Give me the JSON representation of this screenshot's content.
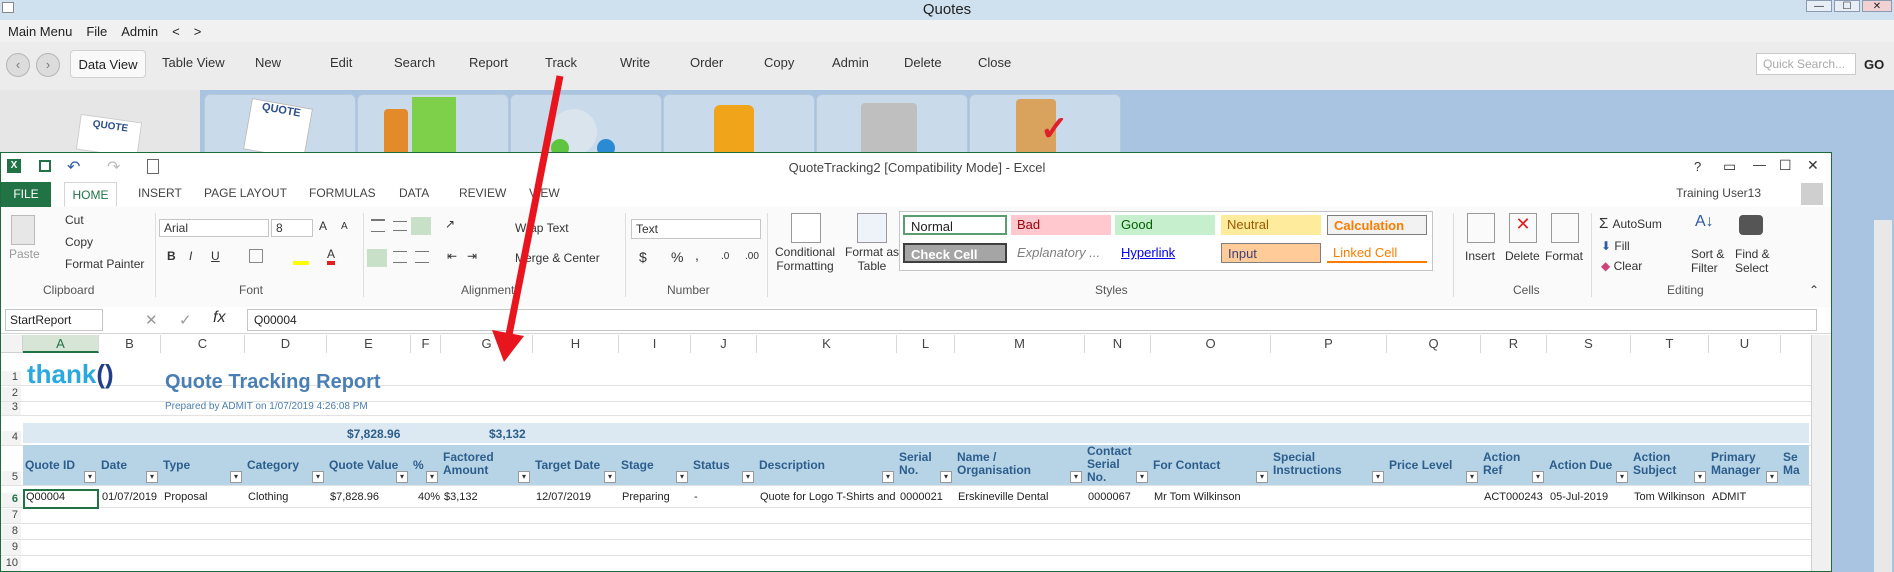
{
  "app": {
    "title": "Quotes",
    "menu": [
      "Main Menu",
      "File",
      "Admin",
      "<",
      ">"
    ],
    "toolbar": [
      "Data View",
      "Table View",
      "New",
      "Edit",
      "Search",
      "Report",
      "Track",
      "Write",
      "Order",
      "Copy",
      "Admin",
      "Delete",
      "Close"
    ],
    "quick_search_placeholder": "Quick Search...",
    "go_label": "GO",
    "tile_texts": [
      "QUOTE",
      "QUOTE"
    ]
  },
  "excel": {
    "title": "QuoteTracking2  [Compatibility Mode] - Excel",
    "window_buttons": [
      "?",
      "▭",
      "—",
      "☐",
      "✕"
    ],
    "tabs": [
      "FILE",
      "HOME",
      "INSERT",
      "PAGE LAYOUT",
      "FORMULAS",
      "DATA",
      "REVIEW",
      "VIEW"
    ],
    "user": "Training User13",
    "clipboard": {
      "paste": "Paste",
      "cut": "Cut",
      "copy": "Copy",
      "format_painter": "Format Painter",
      "label": "Clipboard"
    },
    "font": {
      "name": "Arial",
      "size": "8",
      "bold": "B",
      "italic": "I",
      "underline": "U",
      "label": "Font"
    },
    "alignment": {
      "wrap": "Wrap Text",
      "merge": "Merge & Center",
      "label": "Alignment"
    },
    "number": {
      "format": "Text",
      "currency": "$",
      "percent": "%",
      "comma": ",",
      "label": "Number"
    },
    "styles": {
      "conditional": [
        "Conditional",
        "Formatting"
      ],
      "format_as": [
        "Format as",
        "Table"
      ],
      "cells": [
        {
          "name": "Normal",
          "bg": "#ffffff",
          "fg": "#000000",
          "border": "#5a9e6f"
        },
        {
          "name": "Bad",
          "bg": "#ffc7ce",
          "fg": "#9c0006",
          "border": "#ffc7ce"
        },
        {
          "name": "Good",
          "bg": "#c6efce",
          "fg": "#006100",
          "border": "#c6efce"
        },
        {
          "name": "Neutral",
          "bg": "#ffeb9c",
          "fg": "#9c5700",
          "border": "#ffeb9c"
        },
        {
          "name": "Calculation",
          "bg": "#f2f2f2",
          "fg": "#fa7d00",
          "border": "#7f7f7f"
        },
        {
          "name": "Check Cell",
          "bg": "#a5a5a5",
          "fg": "#ffffff",
          "border": "#3f3f3f"
        },
        {
          "name": "Explanatory ...",
          "bg": "#ffffff",
          "fg": "#7f7f7f",
          "border": "#ffffff"
        },
        {
          "name": "Hyperlink",
          "bg": "#ffffff",
          "fg": "#0000ee",
          "border": "#ffffff"
        },
        {
          "name": "Input",
          "bg": "#ffcc99",
          "fg": "#3f3f76",
          "border": "#7f7f7f"
        },
        {
          "name": "Linked Cell",
          "bg": "#ffffff",
          "fg": "#fa7d00",
          "border": "#ffffff"
        }
      ],
      "label": "Styles"
    },
    "cells_group": {
      "insert": "Insert",
      "delete": "Delete",
      "format": "Format",
      "label": "Cells"
    },
    "editing": {
      "autosum": "AutoSum",
      "fill": "Fill",
      "clear": "Clear",
      "sort": [
        "Sort &",
        "Filter"
      ],
      "find": [
        "Find &",
        "Select"
      ],
      "label": "Editing"
    },
    "name_box": "StartReport",
    "formula_value": "Q00004",
    "columns": [
      "A",
      "B",
      "C",
      "D",
      "E",
      "F",
      "G",
      "H",
      "I",
      "J",
      "K",
      "L",
      "M",
      "N",
      "O",
      "P",
      "Q",
      "R",
      "S",
      "T",
      "U"
    ],
    "rows": [
      "1",
      "2",
      "3",
      "4",
      "5",
      "6",
      "7",
      "8",
      "9",
      "10"
    ],
    "report": {
      "logo": "thank",
      "title": "Quote Tracking Report",
      "subtitle": "Prepared by ADMIT on 1/07/2019 4:26:08 PM",
      "total_value": "$7,828.96",
      "total_factored": "$3,132"
    },
    "headers": [
      [
        "Quote ID"
      ],
      [
        "Date"
      ],
      [
        "Type"
      ],
      [
        "Category"
      ],
      [
        "Quote Value"
      ],
      [
        "%"
      ],
      [
        "Factored",
        "Amount"
      ],
      [
        "Target Date"
      ],
      [
        "Stage"
      ],
      [
        "Status"
      ],
      [
        "Description"
      ],
      [
        "Serial",
        "No."
      ],
      [
        "Name /",
        "Organisation"
      ],
      [
        "Contact",
        "Serial",
        "No."
      ],
      [
        "For Contact"
      ],
      [
        "Special",
        "Instructions"
      ],
      [
        "Price Level"
      ],
      [
        "Action",
        "Ref"
      ],
      [
        "Action Due"
      ],
      [
        "Action",
        "Subject"
      ],
      [
        "Primary",
        "Manager"
      ],
      [
        "Se",
        "Ma"
      ]
    ],
    "row6": [
      "Q00004",
      "01/07/2019",
      "Proposal",
      "Clothing",
      "$7,828.96",
      "40%",
      "$3,132",
      "12/07/2019",
      "Preparing",
      "-",
      "Quote for Logo T-Shirts and I",
      "0000021",
      "Erskineville Dental",
      "0000067",
      "Mr Tom Wilkinson",
      "",
      "",
      "ACT000243",
      "05-Jul-2019",
      "Tom Wilkinson -",
      "ADMIT"
    ]
  }
}
